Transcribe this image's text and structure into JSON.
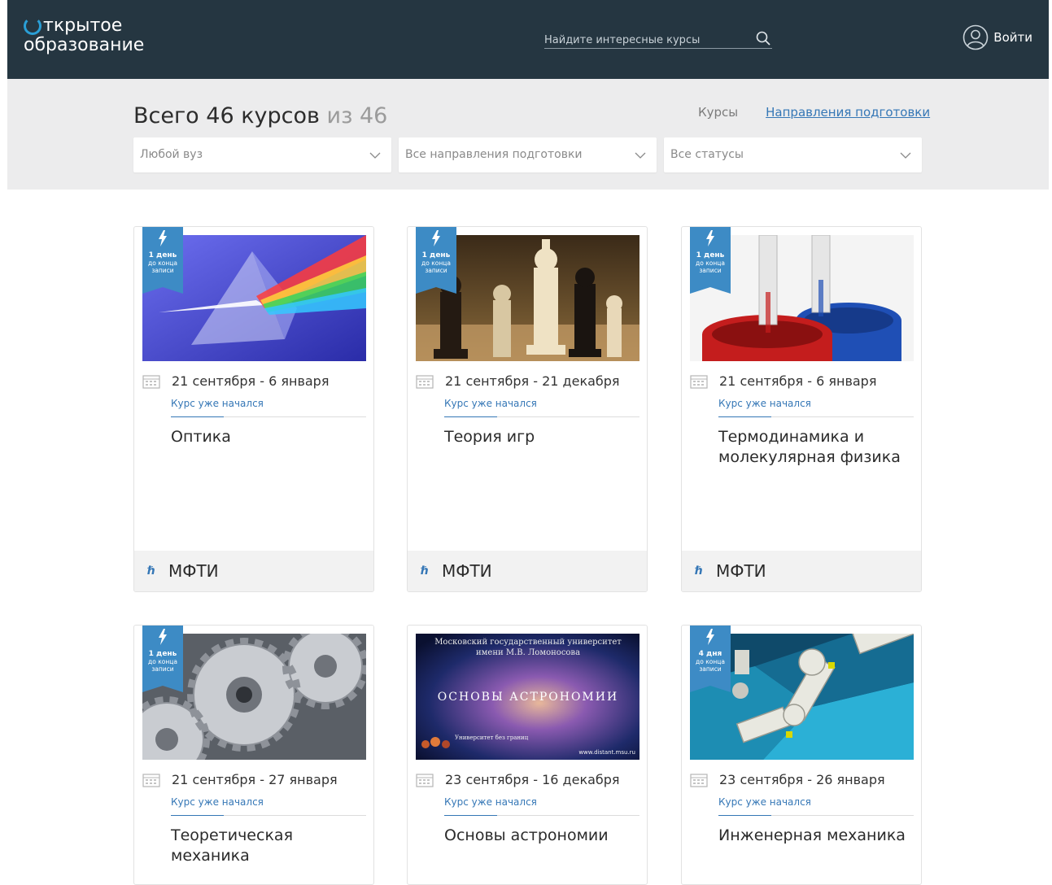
{
  "header": {
    "logo_line1": "ткрытое",
    "logo_line2": "образование",
    "search_placeholder": "Найдите интересные курсы",
    "login_label": "Войти"
  },
  "filters": {
    "total_prefix": "Всего 46 курсов",
    "total_suffix": "из 46",
    "tabs": [
      {
        "label": "Курсы",
        "active": false
      },
      {
        "label": "Направления подготовки",
        "active": true
      }
    ],
    "selects": [
      "Любой вуз",
      "Все направления подготовки",
      "Все статусы"
    ]
  },
  "courses": [
    {
      "badge_days": "1 день",
      "badge_sub": "до конца записи",
      "dates": "21 сентября - 6 января",
      "status": "Курс уже начался",
      "title": "Оптика",
      "university": "МФТИ",
      "image": "prism"
    },
    {
      "badge_days": "1 день",
      "badge_sub": "до конца записи",
      "dates": "21 сентября - 21 декабря",
      "status": "Курс уже начался",
      "title": "Теория игр",
      "university": "МФТИ",
      "image": "chess"
    },
    {
      "badge_days": "1 день",
      "badge_sub": "до конца записи",
      "dates": "21 сентября - 6 января",
      "status": "Курс уже начался",
      "title": "Термодинамика и молекулярная физика",
      "university": "МФТИ",
      "image": "beakers"
    },
    {
      "badge_days": "1 день",
      "badge_sub": "до конца записи",
      "dates": "21 сентября - 27 января",
      "status": "Курс уже начался",
      "title": "Теоретическая механика",
      "university": "",
      "image": "gears"
    },
    {
      "badge_days": "",
      "badge_sub": "",
      "dates": "23 сентября - 16 декабря",
      "status": "Курс уже начался",
      "title": "Основы астрономии",
      "university": "",
      "image": "astronomy",
      "image_text": {
        "top1": "Московский государственный университет",
        "top2": "имени М.В. Ломоносова",
        "main": "ОСНОВЫ АСТРОНОМИИ",
        "corner": "Университет без границ",
        "url": "www.distant.msu.ru"
      }
    },
    {
      "badge_days": "4 дня",
      "badge_sub": "до конца записи",
      "dates": "23 сентября - 26 января",
      "status": "Курс уже начался",
      "title": "Инженерная механика",
      "university": "",
      "image": "robotarm"
    }
  ],
  "colors": {
    "header_bg": "#253641",
    "accent": "#3577b6",
    "badge": "#3d8bc5"
  }
}
